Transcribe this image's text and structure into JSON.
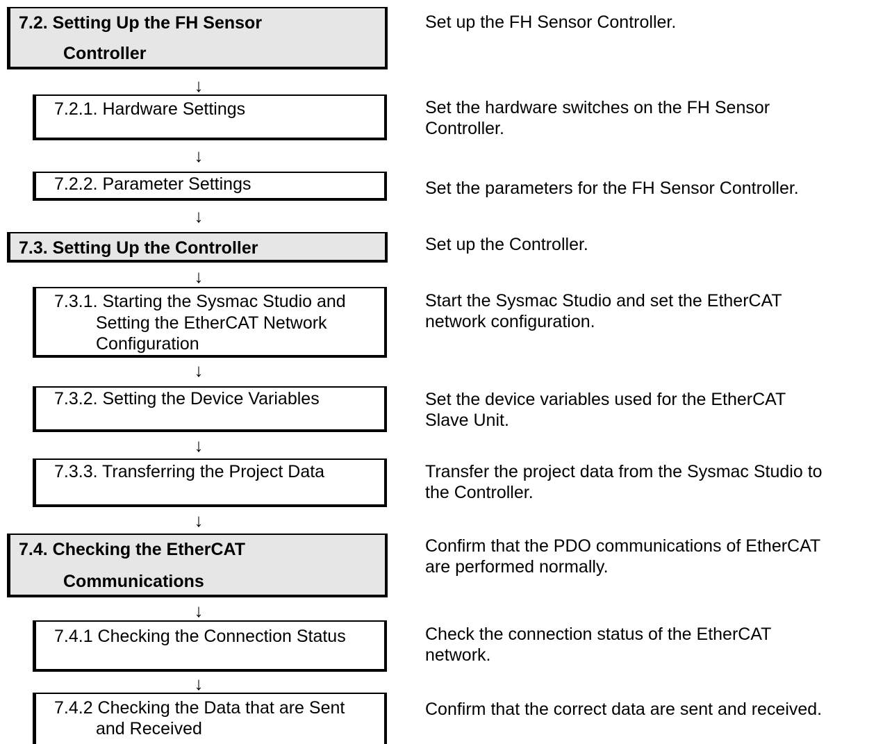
{
  "steps": [
    {
      "title_lines": [
        "7.2. Setting Up the FH Sensor",
        "Controller"
      ],
      "description_lines": [
        "Set up the FH Sensor Controller."
      ]
    },
    {
      "title_lines": [
        "7.2.1. Hardware Settings"
      ],
      "description_lines": [
        "Set the hardware switches on the FH Sensor",
        "Controller."
      ]
    },
    {
      "title_lines": [
        "7.2.2. Parameter Settings"
      ],
      "description_lines": [
        "Set the parameters for the FH Sensor Controller."
      ]
    },
    {
      "title_lines": [
        "7.3. Setting Up the Controller"
      ],
      "description_lines": [
        "Set up the Controller."
      ]
    },
    {
      "title_lines": [
        "7.3.1. Starting the Sysmac Studio and",
        "Setting the EtherCAT Network",
        "Configuration"
      ],
      "description_lines": [
        "Start the Sysmac Studio and set the EtherCAT",
        "network configuration."
      ]
    },
    {
      "title_lines": [
        "7.3.2. Setting the Device Variables"
      ],
      "description_lines": [
        "Set the device variables used for the EtherCAT",
        "Slave Unit."
      ]
    },
    {
      "title_lines": [
        "7.3.3. Transferring the Project Data"
      ],
      "description_lines": [
        "Transfer the project data from the Sysmac Studio to",
        "the Controller."
      ]
    },
    {
      "title_lines": [
        "7.4. Checking the EtherCAT",
        "Communications"
      ],
      "description_lines": [
        "Confirm that the PDO communications of EtherCAT",
        "are performed normally."
      ]
    },
    {
      "title_lines": [
        "7.4.1 Checking the Connection Status"
      ],
      "description_lines": [
        "Check the connection status of the EtherCAT",
        "network."
      ]
    },
    {
      "title_lines": [
        "7.4.2 Checking the Data that are Sent",
        "and Received"
      ],
      "description_lines": [
        "Confirm that the correct data are sent and received."
      ]
    }
  ],
  "arrow_glyph": "↓",
  "colors": {
    "major_fill": "#e6e6e6",
    "sub_fill": "#ffffff",
    "border": "#000000"
  }
}
